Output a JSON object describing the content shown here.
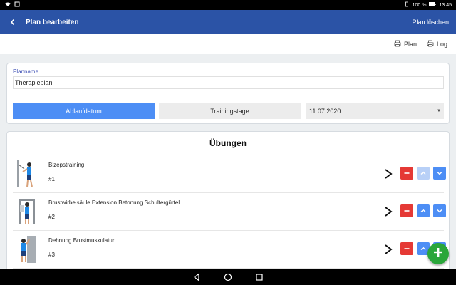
{
  "status_bar": {
    "battery": "100 %",
    "time": "13:45"
  },
  "app_bar": {
    "title": "Plan bearbeiten",
    "delete_label": "Plan löschen"
  },
  "print_bar": {
    "plan_label": "Plan",
    "log_label": "Log"
  },
  "plan_form": {
    "label": "Planname",
    "value": "Therapieplan",
    "segment_active": "Ablaufdatum",
    "segment_inactive": "Trainingstage",
    "date_value": "11.07.2020"
  },
  "exercises": {
    "title": "Übungen",
    "items": [
      {
        "name": "Bizepstraining",
        "number": "#1",
        "up_enabled": false
      },
      {
        "name": "Brustwirbelsäule Extension Betonung Schultergürtel",
        "number": "#2",
        "up_enabled": true
      },
      {
        "name": "Dehnung Brustmuskulatur",
        "number": "#3",
        "up_enabled": true
      }
    ]
  },
  "colors": {
    "primary": "#2b53a6",
    "accent": "#4d8ef5",
    "danger": "#e53935",
    "fab": "#2aa63a"
  }
}
